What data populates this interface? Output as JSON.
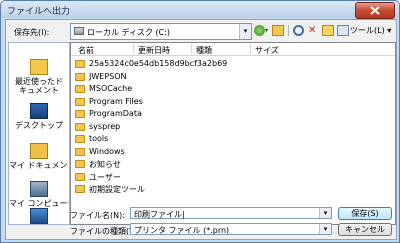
{
  "window": {
    "title": "ファイルへ出力"
  },
  "toolbar": {
    "save_in_label": "保存先(I):",
    "location": "ローカル ディスク (C:)",
    "tools_label": "ツール(L)",
    "tools_arrow": "▾",
    "combo_arrow": "▾",
    "back_dropdown": "▾",
    "delete_icon": "✕"
  },
  "places": [
    {
      "label_line1": "最近使ったド",
      "label_line2": "キュメント"
    },
    {
      "label_line1": "デスクトップ",
      "label_line2": ""
    },
    {
      "label_line1": "マイ ドキュメント",
      "label_line2": ""
    },
    {
      "label_line1": "マイ コンピュータ",
      "label_line2": ""
    },
    {
      "label_line1": "",
      "label_line2": ""
    }
  ],
  "file_list": {
    "columns": [
      "名前",
      "更新日時",
      "種類",
      "サイズ"
    ],
    "items": [
      "25a5324c0e54db158d9bcf3a2b69",
      "JWEPSON",
      "MSOCache",
      "Program Files",
      "ProgramData",
      "sysprep",
      "tools",
      "Windows",
      "お知らせ",
      "ユーザー",
      "初期設定ツール"
    ]
  },
  "filename": {
    "label": "ファイル名(N):",
    "value": "印刷ファイル|"
  },
  "filetype": {
    "label": "ファイルの種類(T):",
    "value": "プリンタ ファイル (*.prn)"
  },
  "buttons": {
    "save": "保存(S)",
    "cancel": "キャンセル"
  }
}
